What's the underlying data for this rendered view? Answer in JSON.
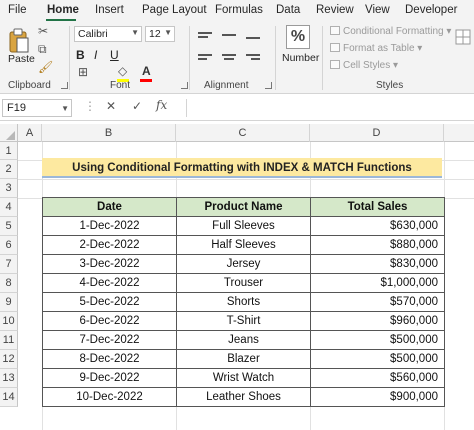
{
  "ribbon": {
    "tabs": [
      "File",
      "Home",
      "Insert",
      "Page Layout",
      "Formulas",
      "Data",
      "Review",
      "View",
      "Developer"
    ],
    "active_tab": "Home",
    "clipboard": {
      "paste_label": "Paste",
      "group_label": "Clipboard"
    },
    "font": {
      "name": "Calibri",
      "size": "12",
      "bold": "B",
      "italic": "I",
      "underline": "U",
      "group_label": "Font",
      "highlight_color": "#ffff00",
      "font_color": "#ff0000"
    },
    "alignment": {
      "group_label": "Alignment"
    },
    "number": {
      "label": "Number",
      "icon": "%"
    },
    "styles": {
      "conditional_formatting": "Conditional Formatting",
      "format_as_table": "Format as Table",
      "cell_styles": "Cell Styles",
      "group_label": "Styles"
    }
  },
  "formula_bar": {
    "name_box": "F19",
    "value": ""
  },
  "grid": {
    "columns": [
      "A",
      "B",
      "C",
      "D"
    ],
    "rows": [
      "1",
      "2",
      "3",
      "4",
      "5",
      "6",
      "7",
      "8",
      "9",
      "10",
      "11",
      "12",
      "13",
      "14"
    ]
  },
  "sheet": {
    "title": "Using Conditional Formatting with INDEX & MATCH Functions",
    "headers": [
      "Date",
      "Product Name",
      "Total Sales"
    ],
    "rows": [
      [
        "1-Dec-2022",
        "Full Sleeves",
        "$630,000"
      ],
      [
        "2-Dec-2022",
        "Half Sleeves",
        "$880,000"
      ],
      [
        "3-Dec-2022",
        "Jersey",
        "$830,000"
      ],
      [
        "4-Dec-2022",
        "Trouser",
        "$1,000,000"
      ],
      [
        "5-Dec-2022",
        "Shorts",
        "$570,000"
      ],
      [
        "6-Dec-2022",
        "T-Shirt",
        "$960,000"
      ],
      [
        "7-Dec-2022",
        "Jeans",
        "$500,000"
      ],
      [
        "8-Dec-2022",
        "Blazer",
        "$500,000"
      ],
      [
        "9-Dec-2022",
        "Wrist Watch",
        "$560,000"
      ],
      [
        "10-Dec-2022",
        "Leather Shoes",
        "$900,000"
      ]
    ],
    "colors": {
      "title_fill": "#fde9a0",
      "header_fill": "#d5e8c9",
      "accent": "#217346"
    }
  }
}
